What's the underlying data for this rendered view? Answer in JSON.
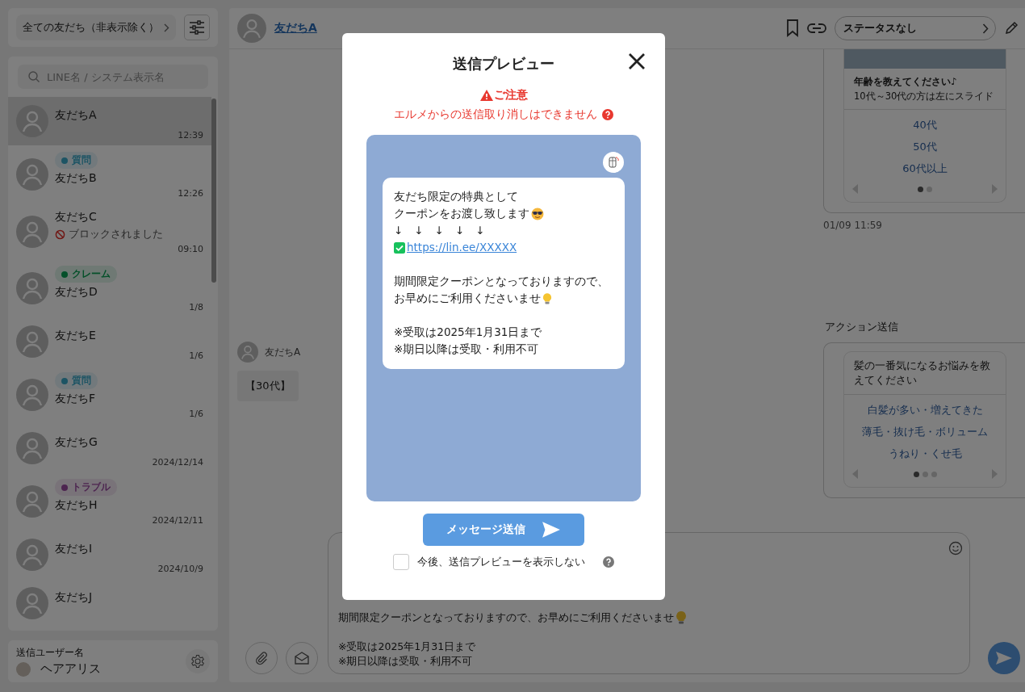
{
  "sidebar": {
    "filter": {
      "label": "全ての友だち（非表示除く）"
    },
    "search": {
      "placeholder": "LINE名 / システム表示名"
    },
    "friends": [
      {
        "name": "友だちA",
        "time": "12:39",
        "selected": true
      },
      {
        "name": "友だちB",
        "tag": {
          "label": "質問",
          "color": "#1d5464"
        },
        "time": "12:26",
        "selected": false
      },
      {
        "name": "友だちC",
        "status": "ブロックされました",
        "time": "09:10",
        "selected": false
      },
      {
        "name": "友だちD",
        "tag": {
          "label": "クレーム",
          "color": "#05502a"
        },
        "time": "1/8",
        "selected": false
      },
      {
        "name": "友だちE",
        "time": "1/6",
        "selected": false
      },
      {
        "name": "友だちF",
        "tag": {
          "label": "質問",
          "color": "#1d5464"
        },
        "time": "1/6",
        "selected": false
      },
      {
        "name": "友だちG",
        "time": "2024/12/14",
        "selected": false
      },
      {
        "name": "友だちH",
        "tag": {
          "label": "トラブル",
          "color": "#4d2550"
        },
        "time": "2024/12/11",
        "selected": false
      },
      {
        "name": "友だちI",
        "time": "2024/10/9",
        "selected": false
      },
      {
        "name": "友だちJ",
        "selected": false
      }
    ],
    "sender": {
      "label": "送信ユーザー名",
      "name": "ヘアアリス"
    }
  },
  "chat": {
    "friend_name": "友だちA",
    "status": "ステータスなし",
    "incoming": {
      "sender": "友だちA",
      "text": "【30代】"
    },
    "outgoing": [
      {
        "kind": "image_carousel",
        "title": "年齢を教えてください♪",
        "text": "10代～30代の方は左にスライド",
        "options": [
          "40代",
          "50代",
          "60代以上"
        ],
        "pages": [
          {
            "selected": true
          },
          {
            "selected": false
          }
        ],
        "time": "01/09 11:59"
      },
      {
        "kind": "text_carousel",
        "label": "アクション送信",
        "title": "髪の一番気になるお悩みを教えてください",
        "options": [
          "白髪が多い・増えてきた",
          "薄毛・抜け毛・ボリューム",
          "うねり・くせ毛"
        ],
        "pages": [
          {
            "selected": true
          },
          {
            "selected": false
          },
          {
            "selected": false
          }
        ]
      }
    ],
    "composer": [
      {
        "kind": "bulb",
        "text": "期間限定クーポンとなっておりますので、お早めにご利用くださいませ"
      },
      {
        "kind": "text",
        "text": "※受取は2025年1月31日まで"
      },
      {
        "kind": "text",
        "text": "※期日以降は受取・利用不可"
      }
    ]
  },
  "modal": {
    "title": "送信プレビュー",
    "notice_title": "ご注意",
    "notice": "エルメからの送信取り消しはできません",
    "message": [
      {
        "lines": [
          {
            "kind": "text",
            "text": "友だち限定の特典として"
          },
          {
            "kind": "sunglasses",
            "text": "クーポンをお渡し致します"
          },
          {
            "kind": "text",
            "text": "↓　↓　↓　↓　↓"
          },
          {
            "kind": "link",
            "text": "https://lin.ee/XXXXX"
          }
        ]
      },
      {
        "lines": [
          {
            "kind": "text",
            "text": "期間限定クーポンとなっておりますので、"
          },
          {
            "kind": "bulb",
            "text": "お早めにご利用くださいませ"
          }
        ]
      },
      {
        "lines": [
          {
            "kind": "text",
            "text": "※受取は2025年1月31日まで"
          },
          {
            "kind": "text",
            "text": "※期日以降は受取・利用不可"
          }
        ]
      }
    ],
    "send_button": "メッセージ送信",
    "option": {
      "label": "今後、送信プレビューを表示しない",
      "checked": false
    }
  }
}
